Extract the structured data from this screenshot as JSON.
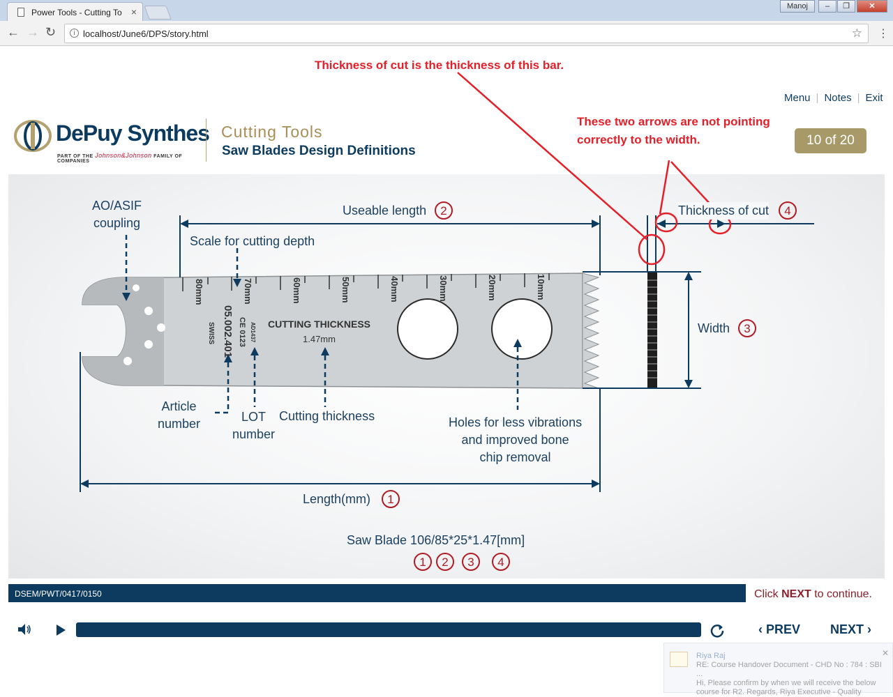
{
  "browser": {
    "tab_title": "Power Tools - Cutting To",
    "url": "localhost/June6/DPS/story.html",
    "user_label": "Manoj"
  },
  "annotations": {
    "top_note": "Thickness of cut is the thickness of this bar.",
    "arrow_note_line1": "These two arrows are not pointing",
    "arrow_note_line2": "correctly to the width."
  },
  "course_nav": {
    "menu": "Menu",
    "notes": "Notes",
    "exit": "Exit"
  },
  "header": {
    "logo_text": "DePuy Synthes",
    "logo_sub_a": "PART OF THE",
    "logo_sub_jnj": "Johnson&Johnson",
    "logo_sub_b": "FAMILY OF COMPANIES",
    "course_title": "Cutting Tools",
    "course_subtitle": "Saw Blades Design Definitions",
    "page_indicator": "10 of 20"
  },
  "diagram": {
    "ao_line1": "AO/ASIF",
    "ao_line2": "coupling",
    "useable_length": "Useable length",
    "useable_num": "2",
    "scale_label": "Scale for cutting depth",
    "thickness_of_cut": "Thickness of cut",
    "thickness_num": "4",
    "width": "Width",
    "width_num": "3",
    "article_line1": "Article",
    "article_line2": "number",
    "lot_line1": "LOT",
    "lot_line2": "number",
    "cutting_thickness": "Cutting thickness",
    "holes_line1": "Holes for less vibrations",
    "holes_line2": "and improved bone",
    "holes_line3": "chip removal",
    "length": "Length(mm)",
    "length_num": "1",
    "formula": "Saw Blade 106/85*25*1.47[mm]",
    "formula_nums": [
      "1",
      "2",
      "3",
      "4"
    ],
    "blade_text_cutting": "CUTTING THICKNESS",
    "blade_text_value": "1.47mm",
    "blade_text_swiss": "SWISS",
    "blade_text_article": "05.002.401",
    "blade_text_ce": "CE 0123",
    "blade_text_lot": "AD1437",
    "scale_marks": [
      "80mm",
      "70mm",
      "60mm",
      "50mm",
      "40mm",
      "30mm",
      "20mm",
      "10mm"
    ]
  },
  "footer": {
    "code": "DSEM/PWT/0417/0150",
    "continue_pre": "Click ",
    "continue_next": "NEXT",
    "continue_post": " to continue.",
    "prev": "PREV",
    "next": "NEXT"
  },
  "notification": {
    "sender": "Riya Raj",
    "line1": "RE: Course Handover Document - CHD No : 784 : SBI ...",
    "line2": "Hi,  Please confirm by when we will receive the below",
    "line3": "course for R2.  Regards,  Riya  Executive - Quality"
  },
  "colors": {
    "brand_navy": "#0d3b5f",
    "brand_gold": "#a89968",
    "annotation_red": "#e3202a",
    "number_red": "#b01c24"
  }
}
